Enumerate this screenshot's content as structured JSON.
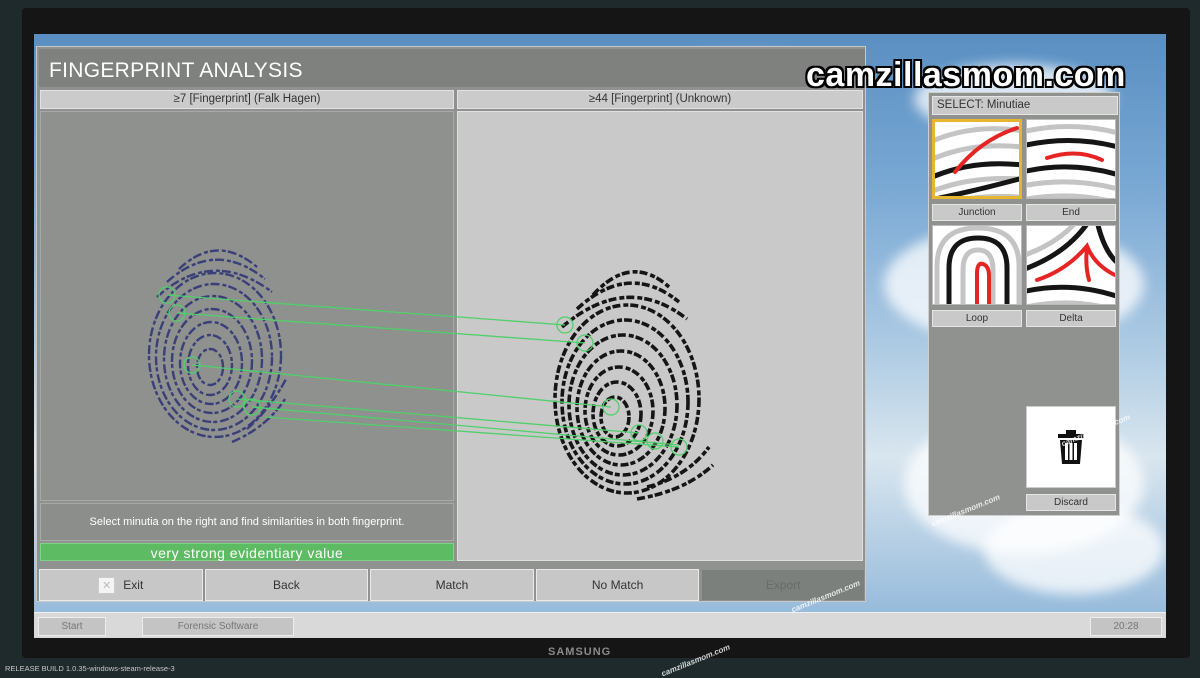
{
  "app": {
    "title": "FINGERPRINT ANALYSIS",
    "left_print": {
      "number": "7",
      "label": "[Fingerprint] (Falk Hagen)"
    },
    "right_print": {
      "number": "44",
      "label": "[Fingerprint] (Unknown)"
    },
    "instruction": "Select minutia on the right and find similarities in both fingerprint.",
    "evidence": "very strong evidentiary value"
  },
  "buttons": {
    "exit": "Exit",
    "back": "Back",
    "match": "Match",
    "no_match": "No Match",
    "export": "Export"
  },
  "minutiae": {
    "header": "SELECT: Minutiae",
    "items": [
      {
        "label": "Junction",
        "selected": true
      },
      {
        "label": "End",
        "selected": false
      },
      {
        "label": "Loop",
        "selected": false
      },
      {
        "label": "Delta",
        "selected": false
      }
    ],
    "discard": "Discard"
  },
  "taskbar": {
    "start": "Start",
    "software": "Forensic Software",
    "clock": "20:28"
  },
  "monitor_brand": "SAMSUNG",
  "build": "RELEASE   BUILD 1.0.35-windows-steam-release-3",
  "watermark": "camzillasmom.com",
  "colors": {
    "evidence_green": "#5dbb63",
    "selection_gold": "#e8b531",
    "match_line": "#4fd06a",
    "minutia_red": "#e62424"
  }
}
